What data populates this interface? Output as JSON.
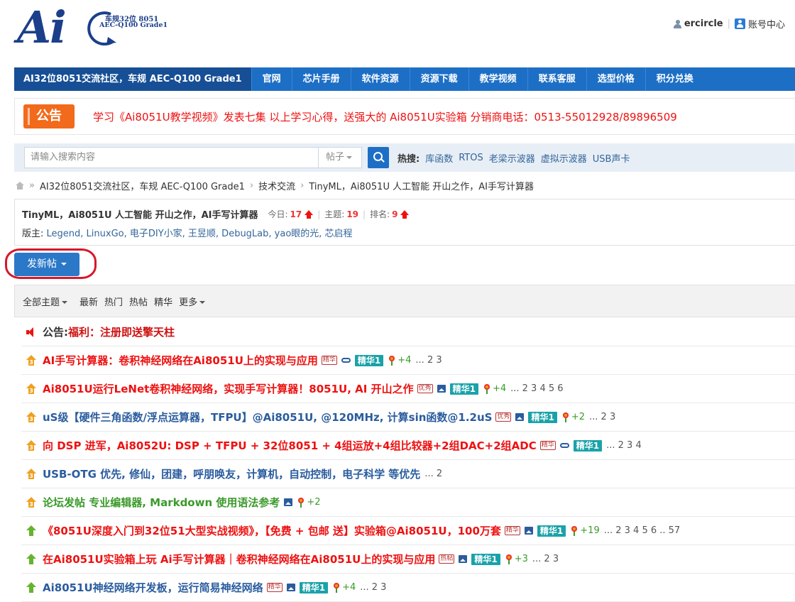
{
  "logo": {
    "text": "Ai",
    "tagline1": "车规32位 8051",
    "tagline2": "AEC-Q100 Grade1"
  },
  "user": {
    "name": "ercircle",
    "account": "账号中心"
  },
  "nav": {
    "home": "AI32位8051交流社区，车规 AEC-Q100 Grade1",
    "items": [
      "官网",
      "芯片手册",
      "软件资源",
      "资源下载",
      "教学视频",
      "联系客服",
      "选型价格",
      "积分兑换"
    ]
  },
  "notice": {
    "badge": "公告",
    "text": "学习《Ai8051U教学视频》发表七集 以上学习心得，送强大的 Ai8051U实验箱  分销商电话：0513-55012928/89896509"
  },
  "search": {
    "placeholder": "请输入搜索内容",
    "type": "帖子",
    "hot_label": "热搜:",
    "hot": [
      "库函数",
      "RTOS",
      "老梁示波器",
      "虚拟示波器",
      "USB声卡"
    ]
  },
  "breadcrumb": [
    "AI32位8051交流社区，车规 AEC-Q100 Grade1",
    "技术交流",
    "TinyML，Ai8051U 人工智能 开山之作，AI手写计算器"
  ],
  "forum": {
    "name": "TinyML，Ai8051U 人工智能 开山之作，AI手写计算器",
    "today_label": "今日:",
    "today": "17",
    "topics_label": "主题:",
    "topics": "19",
    "rank_label": "排名:",
    "rank": "9",
    "mods_label": "版主:",
    "mods": "Legend, LinuxGo, 电子DIY小家, 王昱顺, DebugLab, yao眼的光, 芯启程"
  },
  "new_post": "发新帖",
  "filters": [
    "全部主题",
    "最新",
    "热门",
    "热帖",
    "精华",
    "更多"
  ],
  "announcement": {
    "label": "公告:",
    "title": "福利：注册即送擎天柱"
  },
  "threads": [
    {
      "title": "AI手写计算器：卷积神经网络在Ai8051U上的实现与应用",
      "color": "red",
      "icon": "orange",
      "tag": "精华",
      "image": false,
      "attach": true,
      "jh": "精华1",
      "plus": "+4",
      "pages": "... 2  3"
    },
    {
      "title": "Ai8051U运行LeNet卷积神经网络，实现手写计算器！8051U, AI 开山之作",
      "color": "red",
      "icon": "orange",
      "tag": "优秀",
      "image": true,
      "attach": false,
      "jh": "精华1",
      "plus": "+4",
      "pages": "... 2  3  4  5  6"
    },
    {
      "title": "uS级【硬件三角函数/浮点运算器，TFPU】@Ai8051U, @120MHz, 计算sin函数@1.2uS",
      "color": "blue",
      "icon": "orange",
      "tag": "优秀",
      "image": true,
      "attach": false,
      "jh": "精华1",
      "plus": "+2",
      "pages": "... 2  3"
    },
    {
      "title": "向 DSP 进军，Ai8052U: DSP + TFPU + 32位8051 + 4组运放+4组比较器+2组DAC+2组ADC",
      "color": "red",
      "icon": "orange",
      "tag": "精华",
      "image": false,
      "attach": true,
      "jh": "精华1",
      "plus": "",
      "pages": "... 2  3  4"
    },
    {
      "title": "USB-OTG 优先, 修仙，团建，呼朋唤友，计算机，自动控制，电子科学 等优先",
      "color": "blue",
      "icon": "orange",
      "tag": "",
      "image": false,
      "attach": false,
      "jh": "",
      "plus": "",
      "pages": "... 2"
    },
    {
      "title": "论坛发帖 专业编辑器, Markdown 使用语法参考",
      "color": "green",
      "icon": "orange",
      "tag": "",
      "image": true,
      "attach": false,
      "jh": "",
      "plus": "+2",
      "pages": ""
    },
    {
      "title": "《8051U深度入门到32位51大型实战视频》，【免费 + 包邮 送】实验箱@Ai8051U，100万套",
      "color": "red",
      "icon": "green",
      "tag": "精华",
      "image": true,
      "attach": false,
      "jh": "精华1",
      "plus": "+19",
      "pages": "... 2  3  4  5  6 .. 57"
    },
    {
      "title": "在Ai8051U实验箱上玩 Ai手写计算器｜卷积神经网络在Ai8051U上的实现与应用",
      "color": "red",
      "icon": "green",
      "tag": "热帖",
      "image": true,
      "attach": false,
      "jh": "精华1",
      "plus": "+3",
      "pages": "... 2  3"
    },
    {
      "title": "Ai8051U神经网络开发板，运行简易神经网络",
      "color": "blue",
      "icon": "green",
      "tag": "精华",
      "image": true,
      "attach": false,
      "jh": "精华1",
      "plus": "+4",
      "pages": "... 2  3"
    }
  ]
}
